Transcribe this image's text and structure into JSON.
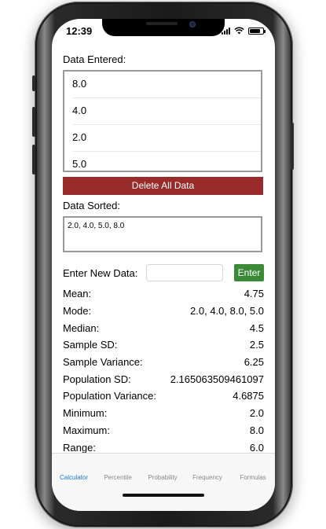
{
  "status": {
    "time": "12:39"
  },
  "data_entered": {
    "label": "Data Entered:",
    "items": [
      "8.0",
      "4.0",
      "2.0",
      "5.0"
    ]
  },
  "delete_button": "Delete All Data",
  "data_sorted": {
    "label": "Data Sorted:",
    "value": "2.0, 4.0, 5.0, 8.0"
  },
  "new_data": {
    "label": "Enter New Data:",
    "input_value": "",
    "enter_label": "Enter"
  },
  "stats": [
    {
      "label": "Mean:",
      "value": "4.75"
    },
    {
      "label": "Mode:",
      "value": "2.0, 4.0, 8.0, 5.0"
    },
    {
      "label": "Median:",
      "value": "4.5"
    },
    {
      "label": "Sample SD:",
      "value": "2.5"
    },
    {
      "label": "Sample Variance:",
      "value": "6.25"
    },
    {
      "label": "Population SD:",
      "value": "2.165063509461097"
    },
    {
      "label": "Population Variance:",
      "value": "4.6875"
    },
    {
      "label": "Minimum:",
      "value": "2.0"
    },
    {
      "label": "Maximum:",
      "value": "8.0"
    },
    {
      "label": "Range:",
      "value": "6.0"
    }
  ],
  "tabs": [
    {
      "label": "Calculator",
      "active": true
    },
    {
      "label": "Percentile",
      "active": false
    },
    {
      "label": "Probability",
      "active": false
    },
    {
      "label": "Frequency",
      "active": false
    },
    {
      "label": "Formulas",
      "active": false
    }
  ],
  "colors": {
    "delete_button": "#9a2b2b",
    "enter_button": "#3c8a37",
    "active_tab": "#1a7be0"
  }
}
